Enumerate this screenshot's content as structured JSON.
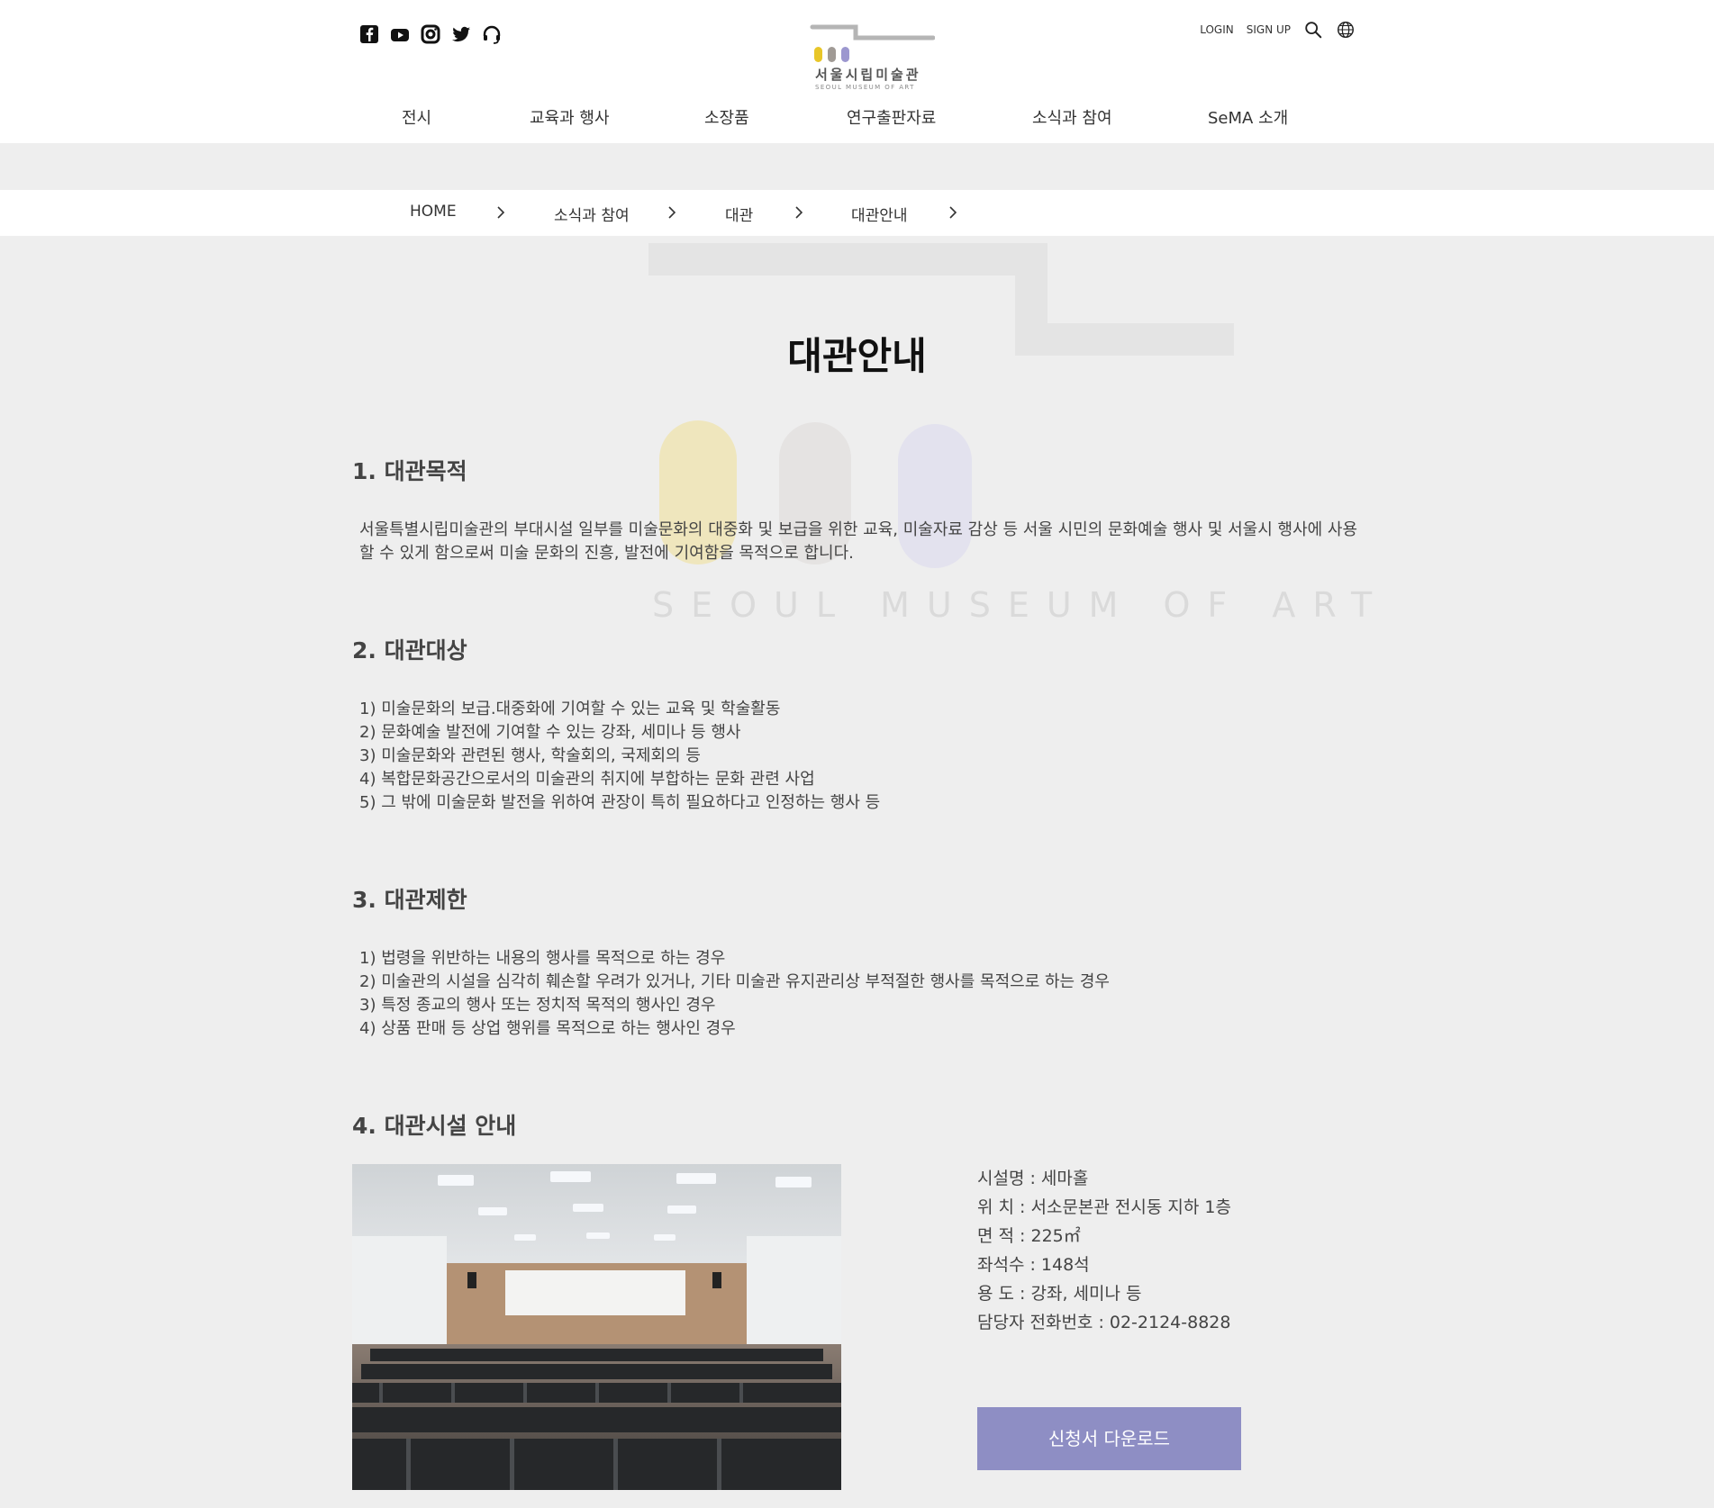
{
  "header": {
    "sns": [
      {
        "icon": "facebook-icon"
      },
      {
        "icon": "youtube-icon"
      },
      {
        "icon": "instagram-icon"
      },
      {
        "icon": "twitter-icon"
      },
      {
        "icon": "audio-guide-icon"
      }
    ],
    "logo": {
      "kr": "서울시립미술관",
      "en": "SEOUL MUSEUM OF ART"
    },
    "util": {
      "login": "LOGIN",
      "signup": "SIGN UP"
    },
    "nav": [
      "전시",
      "교육과 행사",
      "소장품",
      "연구출판자료",
      "소식과 참여",
      "SeMA 소개"
    ]
  },
  "breadcrumb": [
    "HOME",
    "소식과 참여",
    "대관",
    "대관안내"
  ],
  "watermark_text": "SEOUL MUSEUM OF ART",
  "page_title": "대관안내",
  "sections": {
    "purpose": {
      "title": "1. 대관목적",
      "body": "서울특별시립미술관의 부대시설 일부를 미술문화의 대중화 및 보급을 위한 교육, 미술자료 감상 등 서울 시민의 문화예술 행사 및 서울시 행사에 사용할 수 있게 함으로써 미술 문화의 진흥, 발전에 기여함을 목적으로 합니다."
    },
    "target": {
      "title": "2. 대관대상",
      "items": [
        "1) 미술문화의 보급.대중화에 기여할 수 있는 교육 및 학술활동",
        "2) 문화예술 발전에 기여할 수 있는 강좌, 세미나 등 행사",
        "3) 미술문화와 관련된 행사, 학술회의, 국제회의 등",
        "4) 복합문화공간으로서의 미술관의 취지에 부합하는 문화 관련 사업",
        "5) 그 밖에 미술문화 발전을 위하여 관장이 특히 필요하다고 인정하는 행사 등"
      ]
    },
    "restriction": {
      "title": "3. 대관제한",
      "items": [
        "1) 법령을 위반하는 내용의 행사를 목적으로 하는 경우",
        "2) 미술관의 시설을 심각히 훼손할 우려가 있거나, 기타 미술관 유지관리상 부적절한 행사를 목적으로 하는 경우",
        "3) 특정 종교의 행사 또는 정치적 목적의 행사인 경우",
        "4) 상품 판매 등 상업 행위를 목적으로 하는 행사인 경우"
      ]
    },
    "facility": {
      "title": "4. 대관시설 안내",
      "info": [
        "시설명 : 세마홀",
        "위 치 : 서소문본관 전시동 지하 1층",
        "면 적 : 225㎡",
        "좌석수 : 148석",
        "용 도 : 강좌, 세미나 등",
        "담당자 전화번호 : 02-2124-8828"
      ],
      "download_label": "신청서 다운로드"
    }
  },
  "colors": {
    "accent": "#8e8ec4",
    "background": "#eeeeee",
    "logo_yellow": "#e8c628",
    "logo_gray": "#a09a95",
    "logo_purple": "#9c97cf"
  }
}
